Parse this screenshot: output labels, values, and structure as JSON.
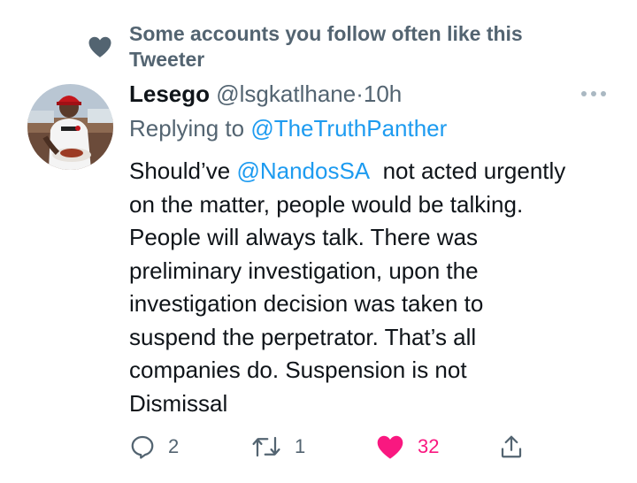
{
  "social_context": {
    "text": "Some accounts you follow often like this Tweeter"
  },
  "tweet": {
    "display_name": "Lesego",
    "handle": "@lsgkatlhane",
    "dot": "·",
    "time": "10h",
    "replying_prefix": "Replying to",
    "replying_to": "@TheTruthPanther",
    "text_lines": [
      {
        "before": "Should’ve",
        "mention": "@NandosSA",
        "after": "not acted urgently"
      },
      "on the matter, people would be talking.",
      "People will always talk. There was",
      "preliminary investigation, upon the",
      "investigation decision was taken to",
      "suspend the perpetrator. That’s all",
      "companies do. Suspension is not",
      "Dismissal"
    ]
  },
  "actions": {
    "reply_count": "2",
    "retweet_count": "1",
    "like_count": "32"
  },
  "colors": {
    "text_primary": "#0f1419",
    "text_secondary": "#536471",
    "link": "#1d9bf0",
    "like_active": "#f91880"
  },
  "icons": [
    "heart-icon",
    "more-icon",
    "reply-icon",
    "retweet-icon",
    "like-icon",
    "share-icon"
  ]
}
